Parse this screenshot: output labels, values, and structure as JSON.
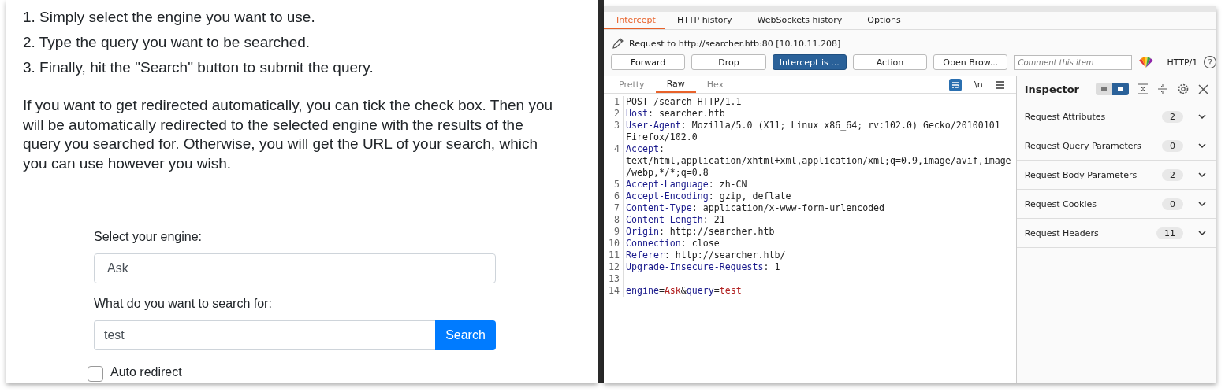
{
  "instructions": {
    "steps": [
      "1. Simply select the engine you want to use.",
      "2. Type the query you want to be searched.",
      "3. Finally, hit the \"Search\" button to submit the query."
    ],
    "paragraph": "If you want to get redirected automatically, you can tick the check box. Then you will be automatically redirected to the selected engine with the results of the query you searched for. Otherwise, you will get the URL of your search, which you can use however you wish."
  },
  "form": {
    "engine_label": "Select your engine:",
    "engine_value": "Ask",
    "query_label": "What do you want to search for:",
    "query_value": "test",
    "search_button": "Search",
    "auto_redirect": {
      "label": "Auto redirect",
      "checked": false
    }
  },
  "burp": {
    "tabs": [
      {
        "label": "Intercept",
        "selected": true
      },
      {
        "label": "HTTP history",
        "selected": false
      },
      {
        "label": "WebSockets history",
        "selected": false
      },
      {
        "label": "Options",
        "selected": false
      }
    ],
    "request_to": "Request to http://searcher.htb:80  [10.10.11.208]",
    "buttons": [
      {
        "label": "Forward",
        "primary": false
      },
      {
        "label": "Drop",
        "primary": false
      },
      {
        "label": "Intercept is ...",
        "primary": true
      },
      {
        "label": "Action",
        "primary": false
      },
      {
        "label": "Open Brow...",
        "primary": false
      }
    ],
    "comment": {
      "placeholder": "Comment this item"
    },
    "protocol": "HTTP/1",
    "help": "?",
    "editor_tabs": [
      {
        "label": "Pretty",
        "selected": false
      },
      {
        "label": "Raw",
        "selected": true
      },
      {
        "label": "Hex",
        "selected": false
      }
    ],
    "newline_toggle": "\\n",
    "lines": [
      {
        "number": "1",
        "segments": [
          {
            "kind": "plain",
            "text": "POST /search HTTP/1.1"
          }
        ]
      },
      {
        "number": "2",
        "segments": [
          {
            "kind": "key",
            "text": "Host"
          },
          {
            "kind": "plain",
            "text": ": searcher.htb"
          }
        ]
      },
      {
        "number": "3",
        "segments": [
          {
            "kind": "key",
            "text": "User-Agent"
          },
          {
            "kind": "plain",
            "text": ": Mozilla/5.0 (X11; Linux x86_64; rv:102.0) Gecko/20100101 Firefox/102.0"
          }
        ]
      },
      {
        "number": "4",
        "segments": [
          {
            "kind": "key",
            "text": "Accept"
          },
          {
            "kind": "plain",
            "text": ": text/html,application/xhtml+xml,application/xml;q=0.9,image/avif,image/webp,*/*;q=0.8"
          }
        ]
      },
      {
        "number": "5",
        "segments": [
          {
            "kind": "key",
            "text": "Accept-Language"
          },
          {
            "kind": "plain",
            "text": ": zh-CN"
          }
        ]
      },
      {
        "number": "6",
        "segments": [
          {
            "kind": "key",
            "text": "Accept-Encoding"
          },
          {
            "kind": "plain",
            "text": ": gzip, deflate"
          }
        ]
      },
      {
        "number": "7",
        "segments": [
          {
            "kind": "key",
            "text": "Content-Type"
          },
          {
            "kind": "plain",
            "text": ": application/x-www-form-urlencoded"
          }
        ]
      },
      {
        "number": "8",
        "segments": [
          {
            "kind": "key",
            "text": "Content-Length"
          },
          {
            "kind": "plain",
            "text": ": 21"
          }
        ]
      },
      {
        "number": "9",
        "segments": [
          {
            "kind": "key",
            "text": "Origin"
          },
          {
            "kind": "plain",
            "text": ": http://searcher.htb"
          }
        ]
      },
      {
        "number": "10",
        "segments": [
          {
            "kind": "key",
            "text": "Connection"
          },
          {
            "kind": "plain",
            "text": ": close"
          }
        ]
      },
      {
        "number": "11",
        "segments": [
          {
            "kind": "key",
            "text": "Referer"
          },
          {
            "kind": "plain",
            "text": ": http://searcher.htb/"
          }
        ]
      },
      {
        "number": "12",
        "segments": [
          {
            "kind": "key",
            "text": "Upgrade-Insecure-Requests"
          },
          {
            "kind": "plain",
            "text": ": 1"
          }
        ]
      },
      {
        "number": "13"
      },
      {
        "number": "14",
        "segments": [
          {
            "kind": "param",
            "text": "engine"
          },
          {
            "kind": "plain",
            "text": "="
          },
          {
            "kind": "arg",
            "text": "Ask"
          },
          {
            "kind": "plain",
            "text": "&"
          },
          {
            "kind": "param",
            "text": "query"
          },
          {
            "kind": "plain",
            "text": "="
          },
          {
            "kind": "arg",
            "text": "test"
          }
        ]
      }
    ],
    "inspector": {
      "title": "Inspector",
      "layout_toggle": [
        {
          "selected": false
        },
        {
          "selected": true
        }
      ],
      "sections": [
        {
          "name": "Request Attributes",
          "count": "2"
        },
        {
          "name": "Request Query Parameters",
          "count": "0"
        },
        {
          "name": "Request Body Parameters",
          "count": "2"
        },
        {
          "name": "Request Cookies",
          "count": "0"
        },
        {
          "name": "Request Headers",
          "count": "11"
        }
      ]
    }
  }
}
